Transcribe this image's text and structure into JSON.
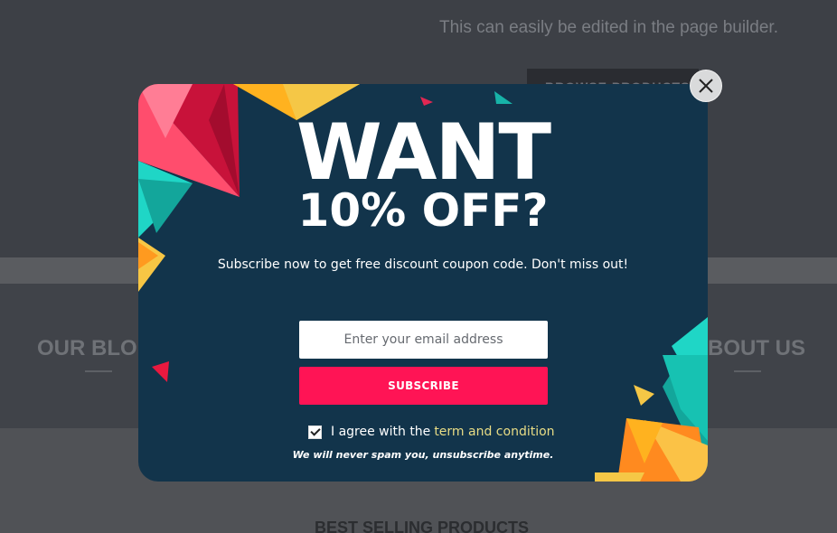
{
  "background": {
    "hero_text": "This can easily be edited in the page builder.",
    "hero_button": "BROWSE PRODUCTS",
    "section_left_title": "OUR BLO",
    "section_right_title": "BOUT US",
    "best_selling": "BEST SELLING PRODUCTS"
  },
  "popup": {
    "headline": "WANT",
    "offer": "10% OFF?",
    "subtitle": "Subscribe now to get free discount coupon code. Don't miss out!",
    "email_placeholder": "Enter your email address",
    "email_value": "",
    "subscribe_label": "SUBSCRIBE",
    "agree_checked": true,
    "agree_text": "I agree with the",
    "agree_link": "term and condition",
    "no_spam": "We will never spam you, unsubscribe anytime.",
    "close_icon": "close-icon"
  },
  "colors": {
    "popup_bg": "#12344b",
    "subscribe_bg": "#ff1455",
    "link": "#e8dc85"
  }
}
